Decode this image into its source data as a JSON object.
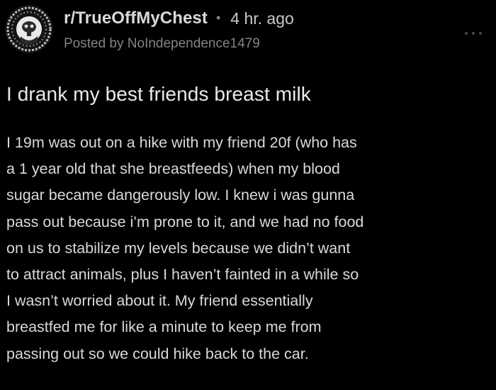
{
  "post": {
    "subreddit": "r/TrueOffMyChest",
    "separator": "•",
    "time_ago": "4 hr. ago",
    "posted_by_prefix": "Posted by ",
    "username": "NoIndependence1479",
    "more_icon": "more-horizontal-icon",
    "avatar_icon": "subreddit-avatar-icon",
    "title": "I drank my best friends breast milk",
    "body_lines": [
      "I 19m was out on a hike with my friend 20f (who has",
      "a 1 year old that she breastfeeds) when my blood",
      "sugar became dangerously low. I knew i was gunna",
      "pass out because i’m prone to it, and we had no food",
      "on us to stabilize my levels because we didn’t want",
      "to attract animals, plus I haven’t fainted in a while so",
      "I wasn’t worried about it. My friend essentially",
      "breastfed me for like a minute to keep me from",
      "passing out so we could hike back to the car."
    ]
  },
  "colors": {
    "background": "#000000",
    "primary_text": "#d7dadc",
    "secondary_text": "#818384",
    "title_text": "#e8eaeb"
  }
}
